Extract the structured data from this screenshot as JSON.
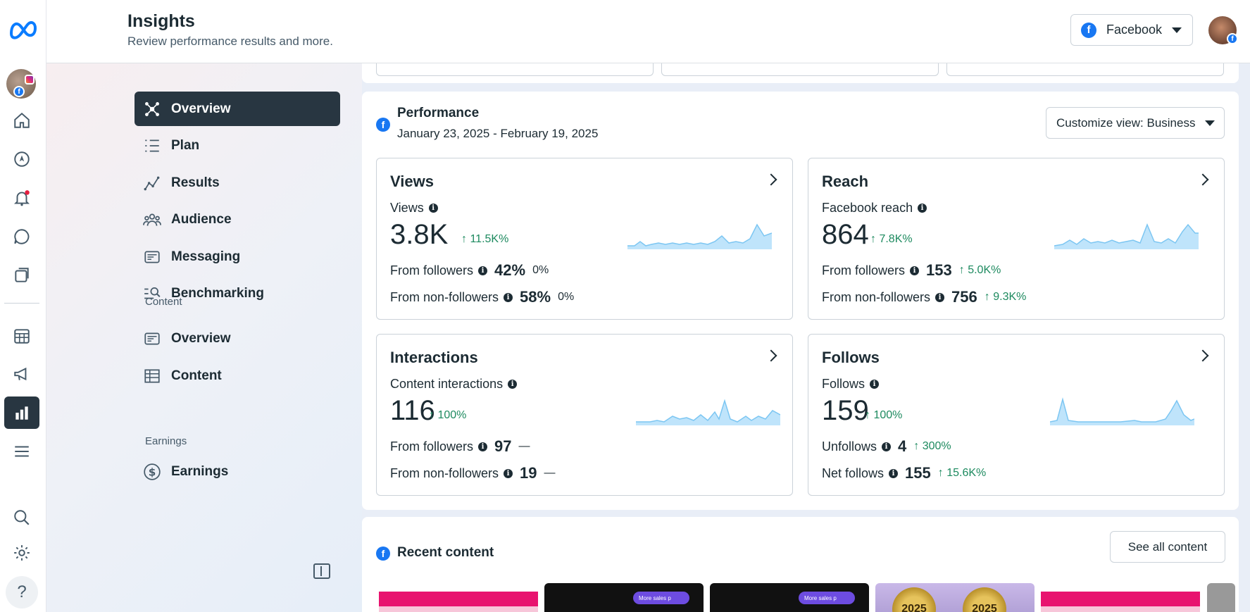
{
  "header": {
    "title": "Insights",
    "subtitle": "Review performance results and more.",
    "account_label": "Facebook"
  },
  "sidebar": {
    "items": [
      {
        "label": "Overview",
        "icon": "overview-icon",
        "active": true
      },
      {
        "label": "Plan",
        "icon": "plan-icon"
      },
      {
        "label": "Results",
        "icon": "results-icon"
      },
      {
        "label": "Audience",
        "icon": "audience-icon"
      },
      {
        "label": "Messaging",
        "icon": "messaging-icon"
      },
      {
        "label": "Benchmarking",
        "icon": "benchmarking-icon"
      }
    ],
    "content_section": "Content",
    "content_items": [
      {
        "label": "Overview",
        "icon": "content-overview-icon"
      },
      {
        "label": "Content",
        "icon": "content-table-icon"
      }
    ],
    "earnings_section": "Earnings",
    "earnings_items": [
      {
        "label": "Earnings",
        "icon": "dollar-icon"
      }
    ]
  },
  "performance": {
    "title": "Performance",
    "date_range": "January 23, 2025 - February 19, 2025",
    "customize_label": "Customize view: Business",
    "cards": {
      "views": {
        "title": "Views",
        "metric_label": "Views",
        "value": "3.8K",
        "delta": "11.5K%",
        "rows": [
          {
            "label": "From followers",
            "value": "42%",
            "change": "0%"
          },
          {
            "label": "From non-followers",
            "value": "58%",
            "change": "0%"
          }
        ]
      },
      "reach": {
        "title": "Reach",
        "metric_label": "Facebook reach",
        "value": "864",
        "delta": "7.8K%",
        "rows": [
          {
            "label": "From followers",
            "value": "153",
            "change": "5.0K%"
          },
          {
            "label": "From non-followers",
            "value": "756",
            "change": "9.3K%"
          }
        ]
      },
      "interactions": {
        "title": "Interactions",
        "metric_label": "Content interactions",
        "value": "116",
        "delta": "100%",
        "rows": [
          {
            "label": "From followers",
            "value": "97",
            "change": "—"
          },
          {
            "label": "From non-followers",
            "value": "19",
            "change": "—"
          }
        ]
      },
      "follows": {
        "title": "Follows",
        "metric_label": "Follows",
        "value": "159",
        "delta": "100%",
        "rows": [
          {
            "label": "Unfollows",
            "value": "4",
            "change": "300%"
          },
          {
            "label": "Net follows",
            "value": "155",
            "change": "15.6K%"
          }
        ]
      }
    }
  },
  "recent": {
    "title": "Recent content",
    "see_all_label": "See all content",
    "thumb_pill": "More sales p",
    "thumb_year": "2025"
  },
  "colors": {
    "accent_dark": "#283641",
    "facebook_blue": "#1877f2",
    "positive_green": "#1d8a5f",
    "sparkline_fill": "#bfe4fb"
  }
}
